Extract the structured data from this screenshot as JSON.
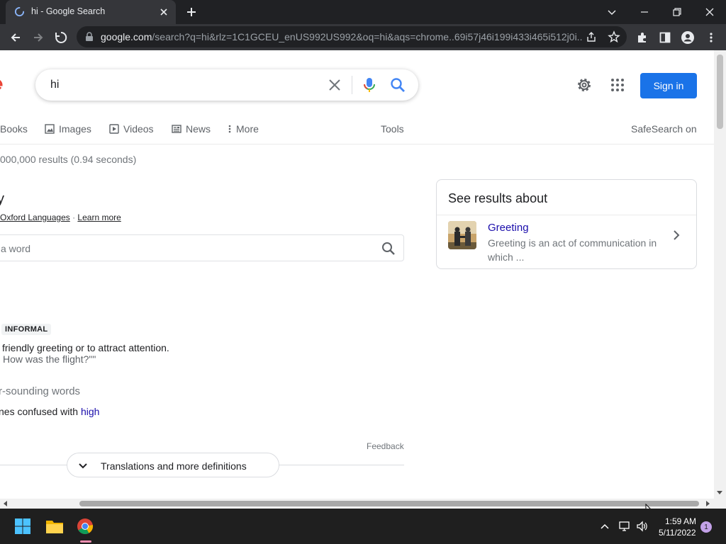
{
  "browser": {
    "tab_title": "hi - Google Search",
    "url_host": "google.com",
    "url_rest": "/search?q=hi&rlz=1C1GCEU_enUS992US992&oq=hi&aqs=chrome..69i57j46i199i433i465i512j0i..."
  },
  "search": {
    "query": "hi",
    "sign_in_label": "Sign in"
  },
  "nav": {
    "books": "Books",
    "images": "Images",
    "videos": "Videos",
    "news": "News",
    "more": "More",
    "tools": "Tools",
    "safesearch": "SafeSearch on"
  },
  "result_stats": "000,000 results (0.94 seconds)",
  "dictionary": {
    "title_fragment": "y",
    "source_link": "Oxford Languages",
    "separator": " · ",
    "learn_more": "Learn more",
    "search_placeholder": "a word",
    "badge": "INFORMAL",
    "definition": "friendly greeting or to attract attention.",
    "example": "How was the flight?\"\"",
    "similar_heading": "r-sounding words",
    "confused_prefix": "nes confused with ",
    "confused_word": "high",
    "feedback": "Feedback",
    "translations_label": "Translations and more definitions"
  },
  "knowledge_card": {
    "title": "See results about",
    "item_title": "Greeting",
    "item_snippet": "Greeting is an act of communication in which ..."
  },
  "taskbar": {
    "time": "1:59 AM",
    "date": "5/11/2022",
    "notification_count": "1"
  },
  "colors": {
    "link": "#1a0dab",
    "accent": "#1a73e8",
    "chrome_dark": "#202124",
    "chrome_toolbar": "#35363a"
  }
}
